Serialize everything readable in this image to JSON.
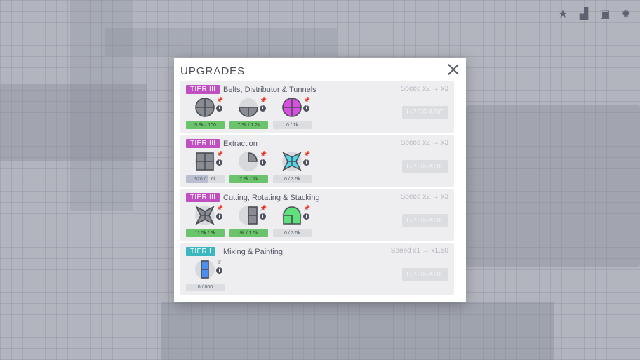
{
  "modal": {
    "title": "UPGRADES"
  },
  "colors": {
    "tier_iii": "#c04fc1",
    "tier_i": "#3cb6bf",
    "progress_done": "#6bc46b",
    "progress_partial": "#b9bfd0",
    "progress_empty": "#dcdde1"
  },
  "top_icons": [
    "star-icon",
    "leaderboard-icon",
    "calendar-icon",
    "settings-icon"
  ],
  "upgrade_button_label": "UPGRADE",
  "upgrades": [
    {
      "tier": "TIER III",
      "tier_color": "#c04fc1",
      "name": "Belts, Distributor & Tunnels",
      "speed": "Speed x2 → x3",
      "requirements": [
        {
          "shape": "circle-quartered-gray-icon",
          "progress_text": "5.8k / 100",
          "progress": 1.0
        },
        {
          "shape": "half-circle-gray-icon",
          "progress_text": "7.3k / 1.2k",
          "progress": 1.0
        },
        {
          "shape": "circle-quartered-purple-icon",
          "progress_text": "0 / 1k",
          "progress": 0.0
        }
      ]
    },
    {
      "tier": "TIER III",
      "tier_color": "#c04fc1",
      "name": "Extraction",
      "speed": "Speed x2 → x3",
      "requirements": [
        {
          "shape": "square-quartered-gray-icon",
          "progress_text": "920 / 1.6k",
          "progress": 0.575
        },
        {
          "shape": "quarter-circle-gray-icon",
          "progress_text": "7.8k / 2k",
          "progress": 1.0
        },
        {
          "shape": "star-cyan-icon",
          "progress_text": "0 / 3.5k",
          "progress": 0.0
        }
      ]
    },
    {
      "tier": "TIER III",
      "tier_color": "#c04fc1",
      "name": "Cutting, Rotating & Stacking",
      "speed": "Speed x2 → x3",
      "requirements": [
        {
          "shape": "star-gray-icon",
          "progress_text": "11.5k / 3k",
          "progress": 1.0
        },
        {
          "shape": "half-square-gray-icon",
          "progress_text": "9k / 1.5k",
          "progress": 1.0
        },
        {
          "shape": "windmill-green-icon",
          "progress_text": "0 / 3.5k",
          "progress": 0.0
        }
      ]
    },
    {
      "tier": "TIER I",
      "tier_color": "#3cb6bf",
      "name": "Mixing & Painting",
      "speed": "Speed x1 → x1.50",
      "requirements": [
        {
          "shape": "half-rect-blue-icon",
          "progress_text": "0 / 800",
          "progress": 0.0
        }
      ]
    }
  ]
}
